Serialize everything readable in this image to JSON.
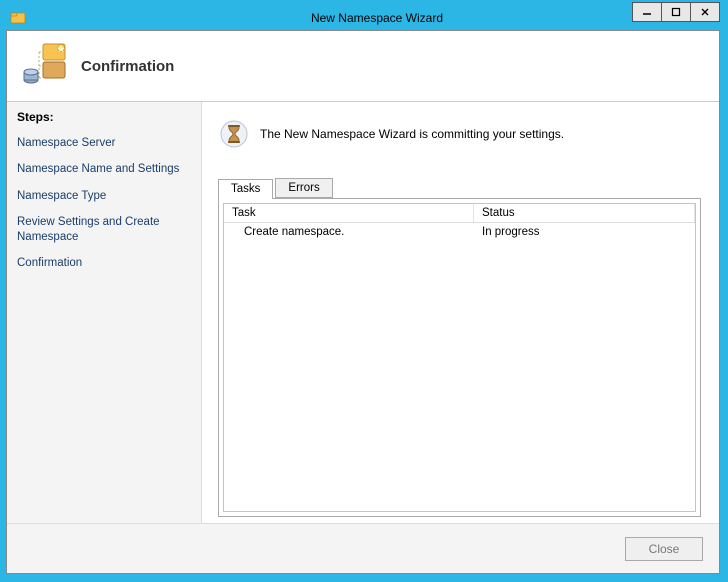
{
  "window": {
    "title": "New Namespace Wizard",
    "icon_name": "namespace-folder-icon"
  },
  "header": {
    "title": "Confirmation"
  },
  "steps": {
    "heading": "Steps:",
    "items": [
      {
        "label": "Namespace Server"
      },
      {
        "label": "Namespace Name and Settings"
      },
      {
        "label": "Namespace Type"
      },
      {
        "label": "Review Settings and Create Namespace"
      },
      {
        "label": "Confirmation"
      }
    ]
  },
  "main": {
    "status_text": "The New Namespace Wizard is committing your settings.",
    "tabs": [
      {
        "label": "Tasks"
      },
      {
        "label": "Errors"
      }
    ],
    "columns": {
      "task": "Task",
      "status": "Status"
    },
    "rows": [
      {
        "task": "Create namespace.",
        "status": "In progress"
      }
    ]
  },
  "buttons": {
    "close": "Close"
  }
}
